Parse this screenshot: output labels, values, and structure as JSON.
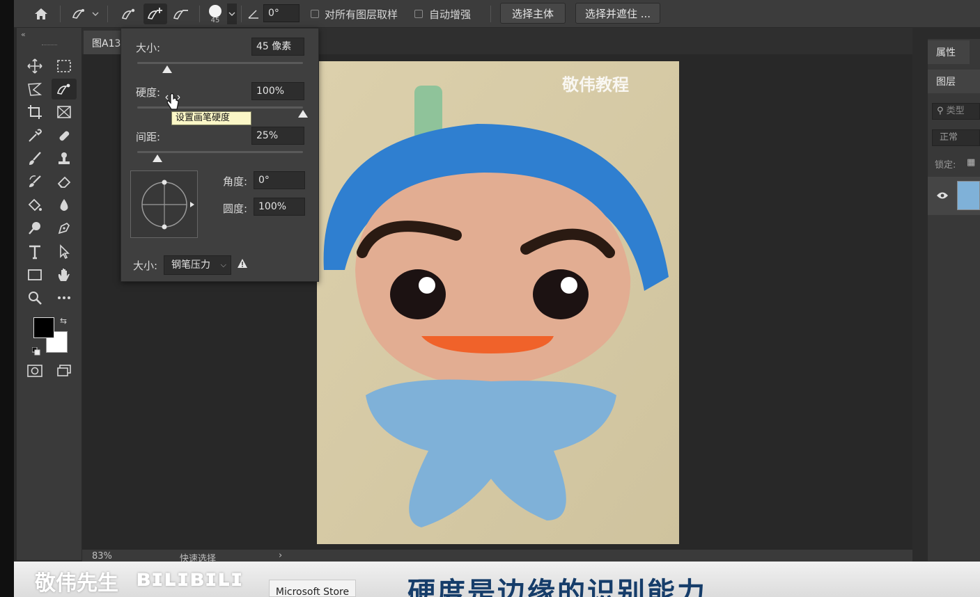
{
  "options_bar": {
    "brush_size_value": "45",
    "angle_value": "0°",
    "sample_all_layers_label": "对所有图层取样",
    "auto_enhance_label": "自动增强",
    "select_subject_label": "选择主体",
    "select_and_mask_label": "选择并遮住 ..."
  },
  "document": {
    "tab_label": "图A13",
    "zoom": "83%",
    "status_tool": "快速选择",
    "photo_watermark": "敬伟教程"
  },
  "brush_popup": {
    "size_label": "大小:",
    "size_value": "45 像素",
    "size_fraction": 0.18,
    "hardness_label": "硬度:",
    "hardness_value": "100%",
    "hardness_fraction": 1.0,
    "spacing_label": "间距:",
    "spacing_value": "25%",
    "spacing_fraction": 0.12,
    "tooltip": "设置画笔硬度",
    "angle_label": "角度:",
    "angle_value": "0°",
    "roundness_label": "圆度:",
    "roundness_value": "100%",
    "pressure_label": "大小:",
    "pressure_value": "钢笔压力"
  },
  "right_panel": {
    "properties_tab": "属性",
    "layers_tab": "图层",
    "search_placeholder": "类型",
    "blend_mode": "正常",
    "lock_label": "锁定:"
  },
  "subtitle_bar": {
    "brand": "敬伟先生",
    "subtitle": "硬度是边缘的识别能力",
    "store_popup": "Microsoft Store"
  },
  "colors": {
    "accent_blue": "#163d6a",
    "foreground": "#000000",
    "background": "#ffffff"
  }
}
